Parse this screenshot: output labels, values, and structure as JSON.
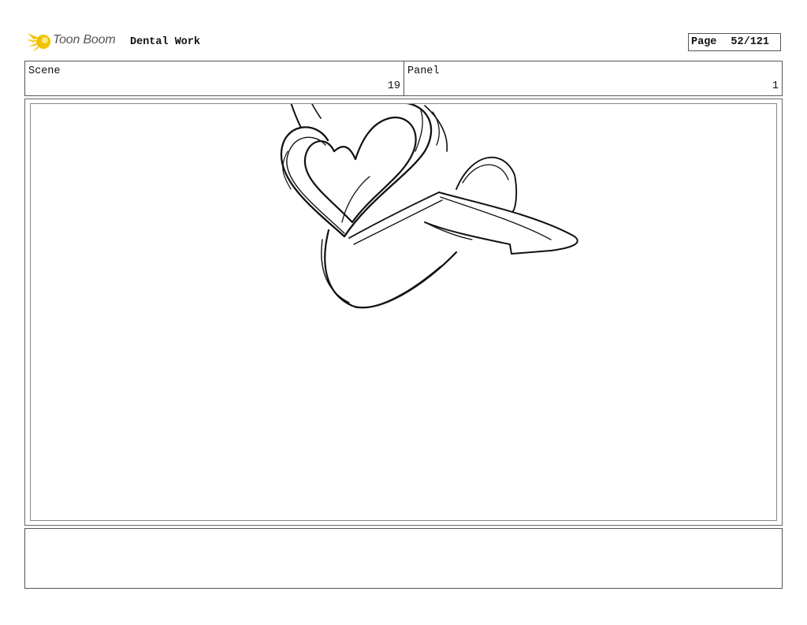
{
  "header": {
    "logo_text": "Toon Boom",
    "project_title": "Dental Work",
    "page_label": "Page",
    "page_number": "52/121"
  },
  "info": {
    "scene_label": "Scene",
    "scene_value": "19",
    "panel_label": "Panel",
    "panel_value": "1"
  },
  "notes": {
    "text": ""
  },
  "colors": {
    "logo_accent": "#f2c200",
    "border": "#555555",
    "sketch_stroke": "#111111"
  },
  "icons": {
    "logo": "toon-boom-star-icon"
  }
}
